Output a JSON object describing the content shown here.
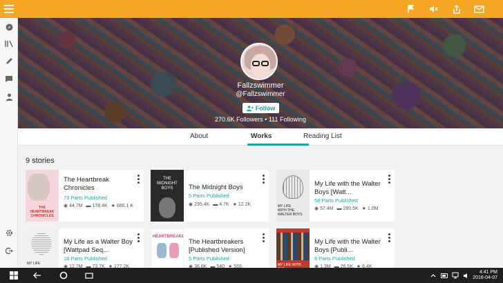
{
  "profile": {
    "username": "Fallzswimmer",
    "handle": "@Fallzswimmer",
    "follow_label": "Follow",
    "followers": "270.6K Followers",
    "separator": "•",
    "following": "111 Following"
  },
  "tabs": [
    {
      "label": "About"
    },
    {
      "label": "Works",
      "active": true
    },
    {
      "label": "Reading List"
    }
  ],
  "story_count": "9 stories",
  "stories": [
    {
      "title": "The Heartbreak Chronicles",
      "parts": "73 Parts Published",
      "reads": "44.7M",
      "votes": "178.4K",
      "comments": "686.1 K",
      "cover_color": "#f4d6dc"
    },
    {
      "title": "The Midnight Boys",
      "parts": "5 Parts Published",
      "reads": "295.4K",
      "votes": "4.7K",
      "comments": "12.2K",
      "cover_color": "#2a2a2a"
    },
    {
      "title": "My Life with the Walter Boys [Watt...",
      "parts": "58 Parts Published",
      "reads": "57.4M",
      "votes": "280.5K",
      "comments": "1.0M",
      "cover_color": "#e8e8e8"
    },
    {
      "title": "My Life as a Walter Boy [Wattpad Seq...",
      "parts": "18 Parts Published",
      "reads": "12.7M",
      "votes": "73.7K",
      "comments": "177.2K",
      "cover_color": "#f0f0f0"
    },
    {
      "title": "The Heartbreakers [Published Version]",
      "parts": "5 Parts Published",
      "reads": "36.6K",
      "votes": "540",
      "comments": "555",
      "cover_color": "#ffffff"
    },
    {
      "title": "My Life with the Walter Boys [Publi...",
      "parts": "6 Parts Published",
      "reads": "1.3M",
      "votes": "26.5K",
      "comments": "6.4K",
      "cover_color": "#c23a2b"
    }
  ],
  "taskbar": {
    "time": "4:41 PM",
    "date": "2016-04-07"
  },
  "colors": {
    "accent": "#f5a623",
    "teal": "#1aa4a0"
  }
}
